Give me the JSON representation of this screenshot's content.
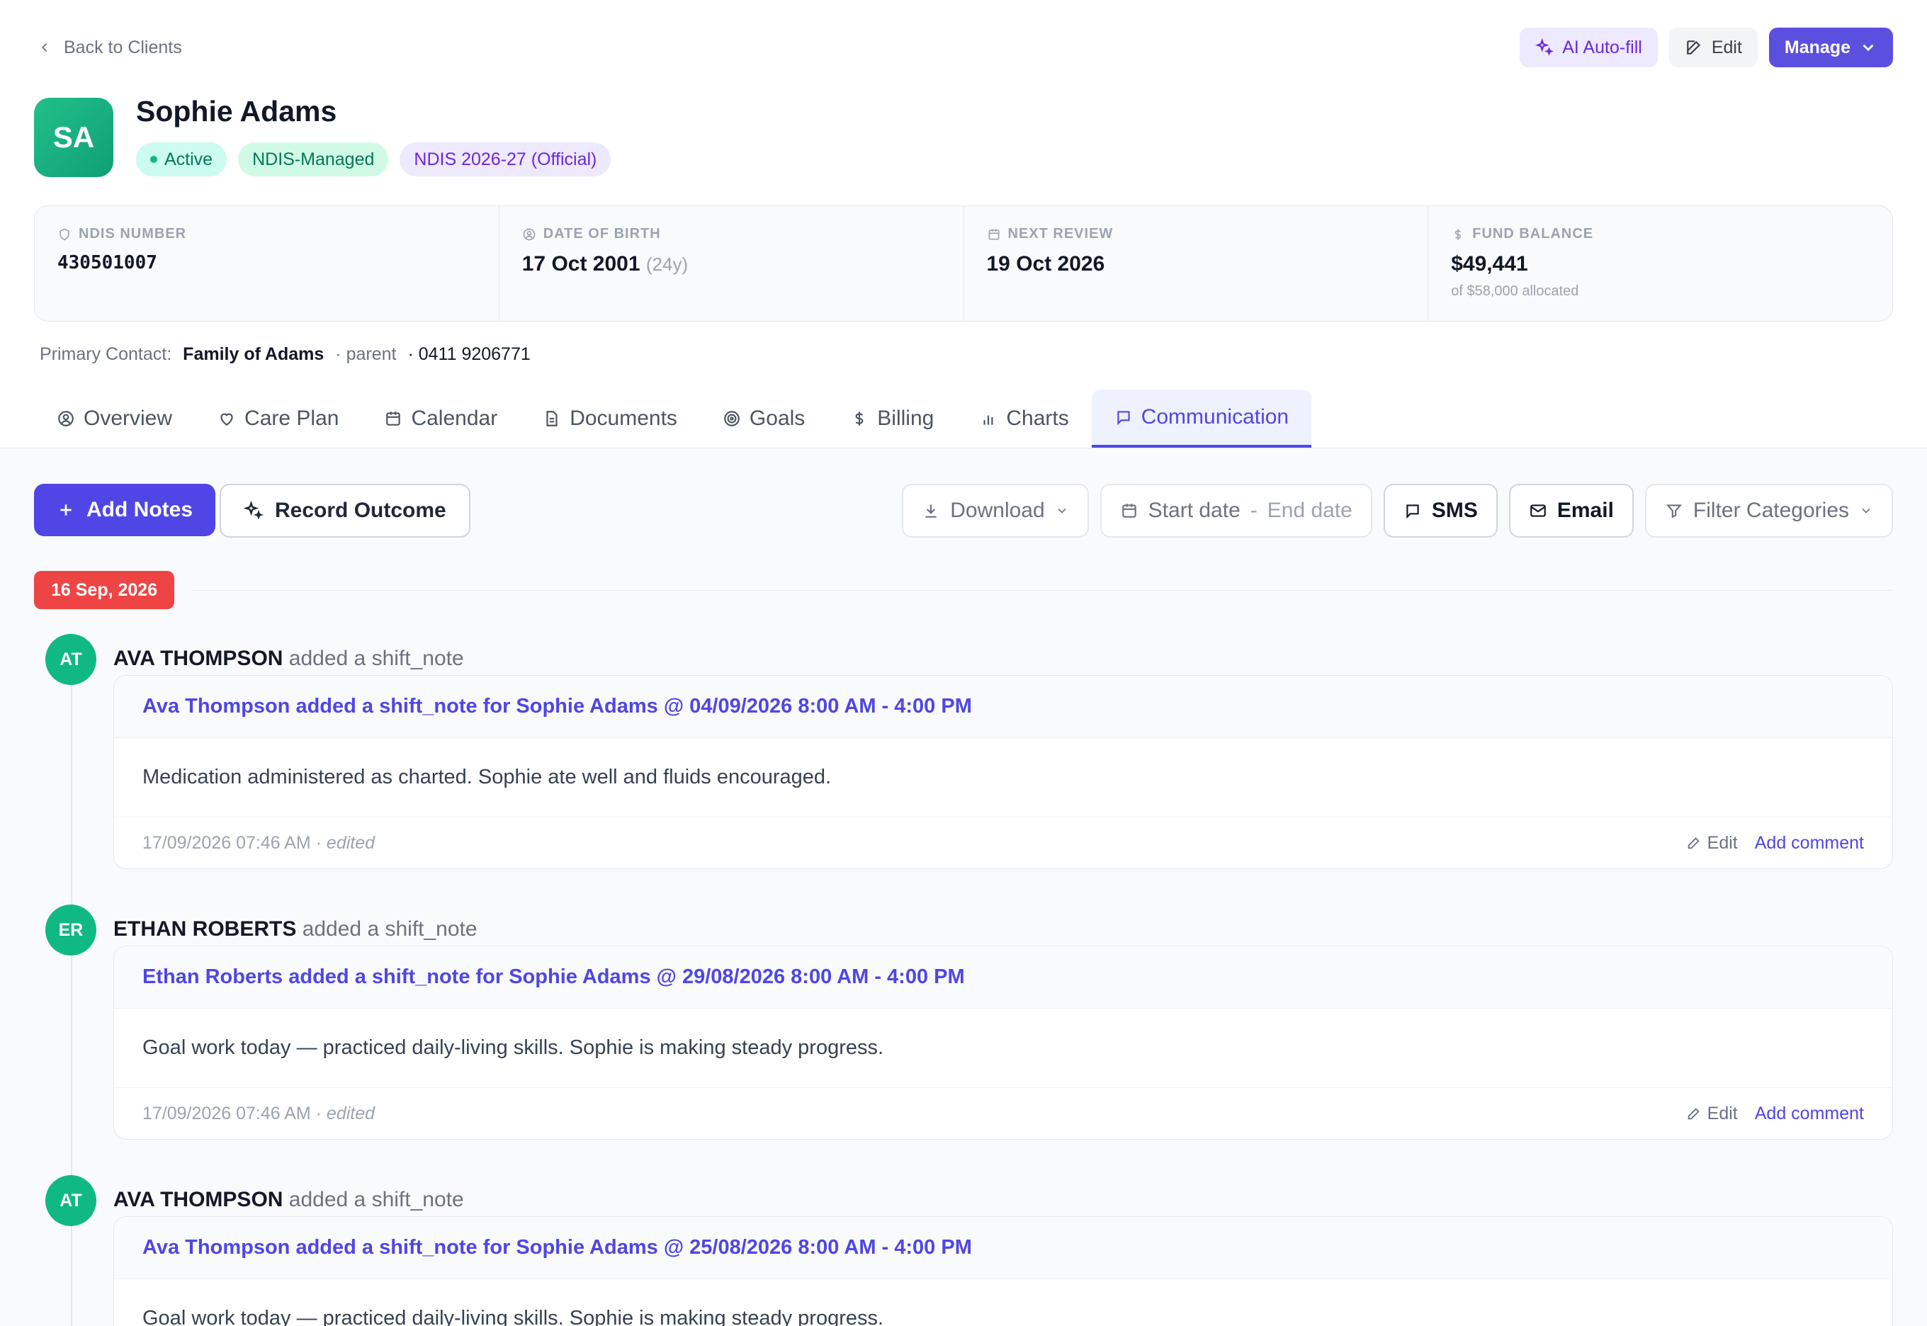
{
  "nav": {
    "back_label": "Back to Clients"
  },
  "actions": {
    "ai_autofill": "AI Auto-fill",
    "edit": "Edit",
    "manage": "Manage"
  },
  "client": {
    "initials": "SA",
    "name": "Sophie Adams",
    "status": "Active",
    "funding": "NDIS-Managed",
    "plan": "NDIS 2026-27 (Official)"
  },
  "stats": {
    "ndis_label": "NDIS NUMBER",
    "ndis_value": "430501007",
    "dob_label": "DATE OF BIRTH",
    "dob_value": "17 Oct 2001",
    "dob_age": "(24y)",
    "review_label": "NEXT REVIEW",
    "review_value": "19 Oct 2026",
    "fund_label": "FUND BALANCE",
    "fund_value": "$49,441",
    "fund_sub": "of $58,000 allocated"
  },
  "contact": {
    "label": "Primary Contact:",
    "name": "Family of Adams",
    "relation": "· parent",
    "phone": "· 0411 9206771"
  },
  "tabs": {
    "overview": "Overview",
    "care_plan": "Care Plan",
    "calendar": "Calendar",
    "documents": "Documents",
    "goals": "Goals",
    "billing": "Billing",
    "charts": "Charts",
    "communication": "Communication"
  },
  "toolbar": {
    "add_notes": "Add Notes",
    "record_outcome": "Record Outcome",
    "download": "Download",
    "start_date": "Start date",
    "date_sep": "-",
    "end_date": "End date",
    "sms": "SMS",
    "email": "Email",
    "filter": "Filter Categories"
  },
  "timeline": {
    "date_chip": "16 Sep, 2026",
    "entries": [
      {
        "initials": "AT",
        "author": "AVA THOMPSON",
        "action": "added a shift_note",
        "title": "Ava Thompson added a shift_note for Sophie Adams @ 04/09/2026 8:00 AM - 4:00 PM",
        "body": "Medication administered as charted. Sophie ate well and fluids encouraged.",
        "timestamp": "17/09/2026 07:46 AM",
        "edited": "· edited",
        "edit_label": "Edit",
        "comment_label": "Add comment"
      },
      {
        "initials": "ER",
        "author": "ETHAN ROBERTS",
        "action": "added a shift_note",
        "title": "Ethan Roberts added a shift_note for Sophie Adams @ 29/08/2026 8:00 AM - 4:00 PM",
        "body": "Goal work today — practiced daily-living skills. Sophie is making steady progress.",
        "timestamp": "17/09/2026 07:46 AM",
        "edited": "· edited",
        "edit_label": "Edit",
        "comment_label": "Add comment"
      },
      {
        "initials": "AT",
        "author": "AVA THOMPSON",
        "action": "added a shift_note",
        "title": "Ava Thompson added a shift_note for Sophie Adams @ 25/08/2026 8:00 AM - 4:00 PM",
        "body": "Goal work today — practiced daily-living skills. Sophie is making steady progress."
      }
    ]
  },
  "colors": {
    "accent": "#4f46e5",
    "manage_button": "#5b4fe0",
    "date_chip": "#ef4444",
    "avatar_green": "#10b981"
  }
}
